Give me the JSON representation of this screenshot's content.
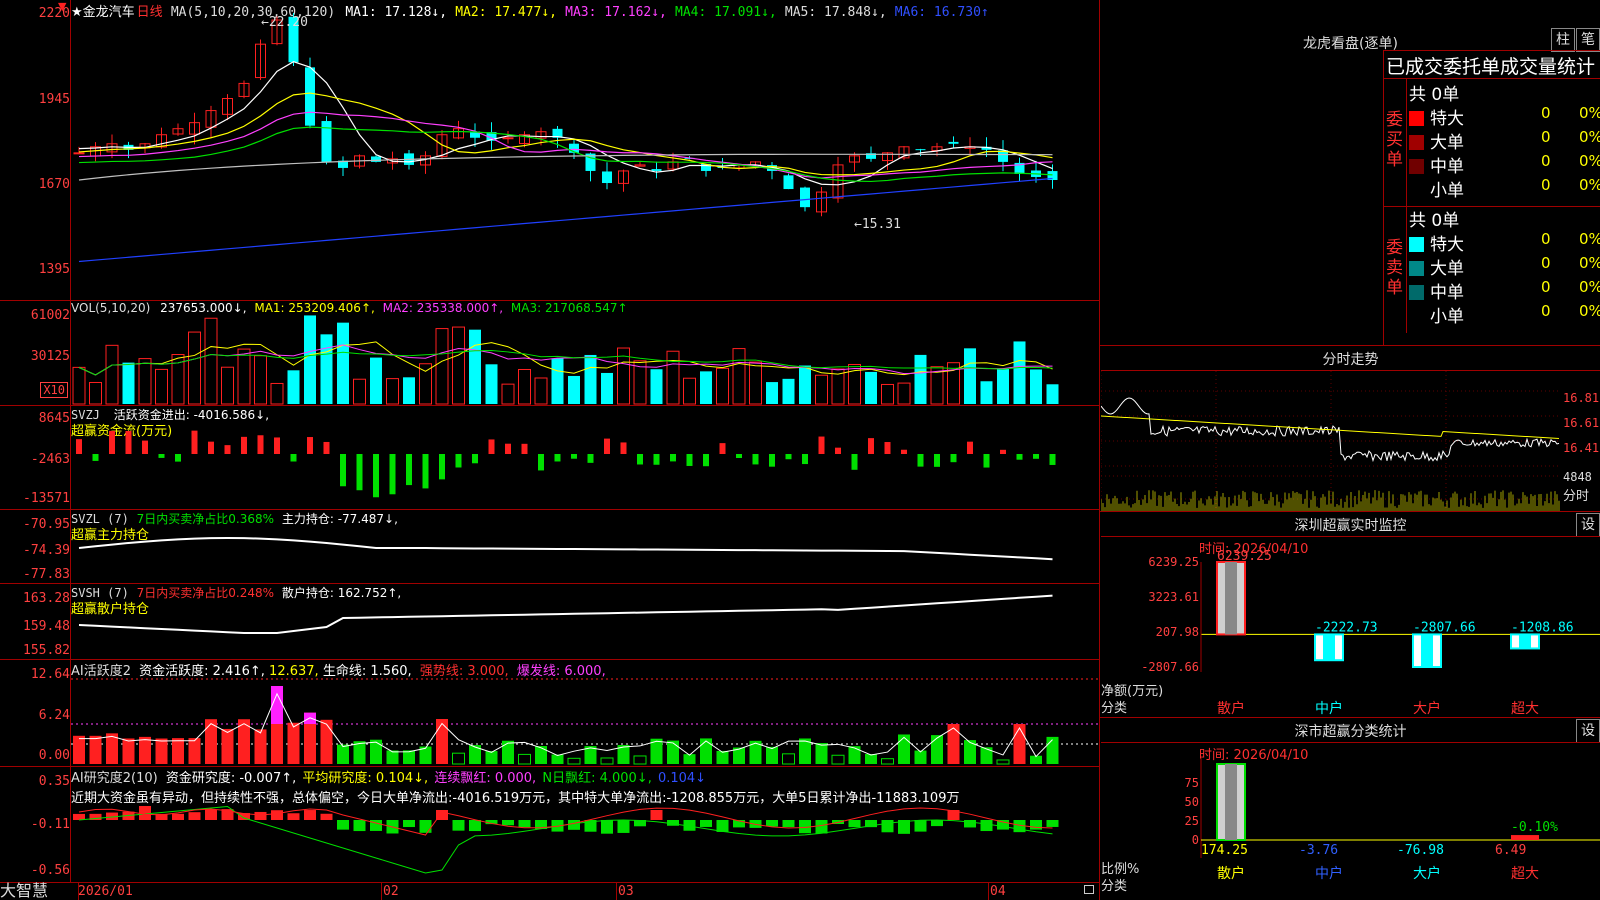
{
  "app": {
    "brand": "大智慧"
  },
  "main": {
    "title_star": "★",
    "stock_name": "金龙汽车",
    "period": "日线",
    "ma_def": "MA(5,10,20,30,60,120)",
    "ma1": "MA1: 17.128↓,",
    "ma2": "MA2: 17.477↓,",
    "ma3": "MA3: 17.162↓,",
    "ma4": "MA4: 17.091↓,",
    "ma5": "MA5: 17.848↓,",
    "ma6": "MA6: 16.730↑",
    "yticks": [
      "2220",
      "1945",
      "1670",
      "1395"
    ],
    "high_label": "←22.20",
    "low_label": "←15.31",
    "colors": {
      "ma1": "#ffffff",
      "ma2": "#ffff00",
      "ma3": "#ff40ff",
      "ma4": "#00e000",
      "ma5": "#c0c0c0",
      "ma6": "#2040ff",
      "up": "#ff2020",
      "down": "#00ffff"
    }
  },
  "vol": {
    "def": "VOL(5,10,20)",
    "v": "237653.000↓,",
    "ma1": "MA1: 253209.406↑,",
    "ma2": "MA2: 235338.000↑,",
    "ma3": "MA3: 217068.547↑",
    "yticks": [
      "61002",
      "30125"
    ],
    "unit": "X10"
  },
  "svzj": {
    "name": "SVZJ",
    "text1": "活跃资金进出: -4016.586↓,",
    "subtitle": "超赢资金流(万元)",
    "yticks": [
      "8645",
      "-2463",
      "-13571"
    ]
  },
  "svzl": {
    "name": "SVZL (7)",
    "text1": "7日内买卖净占比0.368%",
    "text2": "主力持仓: -77.487↓,",
    "subtitle": "超赢主力持仓",
    "yticks": [
      "-70.95",
      "-74.39",
      "-77.83"
    ]
  },
  "svsh": {
    "name": "SVSH (7)",
    "text1": "7日内买卖净占比0.248%",
    "text2": "散户持仓: 162.752↑,",
    "subtitle": "超赢散户持仓",
    "yticks": [
      "163.28",
      "159.48",
      "155.82"
    ]
  },
  "ai1": {
    "name": "AI活跃度2",
    "t1": "资金活跃度: 2.416↑,",
    "t2": "12.637,",
    "t3": "生命线: 1.560,",
    "t4": "强势线: 3.000,",
    "t5": "爆发线: 6.000,",
    "yticks": [
      "12.64",
      "6.24",
      "0.00"
    ]
  },
  "ai2": {
    "name": "AI研究度2(10)",
    "t1": "资金研究度: -0.007↑,",
    "t2": "平均研究度: 0.104↓,",
    "t3": "连续飘红: 0.000,",
    "t4": "N日飘红: 4.000↓,",
    "t5": "0.104↓",
    "comment": "近期大资金虽有异动，但持续性不强，总体偏空，今日大单净流出:-4016.519万元，其中特大单净流出:-1208.855万元，大单5日累计净出-11883.109万",
    "yticks": [
      "0.35",
      "-0.11",
      "-0.56"
    ]
  },
  "xaxis": {
    "labels": [
      "2026/01",
      "02",
      "03",
      "04"
    ]
  },
  "right": {
    "lhb": {
      "title": "龙虎看盘(逐单)",
      "btn1": "柱",
      "btn2": "笔",
      "subtitle": "已成交委托单成交量统计",
      "buy_label": "委买单",
      "sell_label": "委卖单",
      "buy_total": "共 0单",
      "sell_total": "共 0单",
      "buy_rows": [
        {
          "name": "特大",
          "count": "0",
          "pct": "0%",
          "color": "#ff0000"
        },
        {
          "name": "大单",
          "count": "0",
          "pct": "0%",
          "color": "#a00000"
        },
        {
          "name": "中单",
          "count": "0",
          "pct": "0%",
          "color": "#700000"
        },
        {
          "name": "小单",
          "count": "0",
          "pct": "0%",
          "color": ""
        }
      ],
      "sell_rows": [
        {
          "name": "特大",
          "count": "0",
          "pct": "0%",
          "color": "#00ffff"
        },
        {
          "name": "大单",
          "count": "0",
          "pct": "0%",
          "color": "#008888"
        },
        {
          "name": "中单",
          "count": "0",
          "pct": "0%",
          "color": "#006a6a"
        },
        {
          "name": "小单",
          "count": "0",
          "pct": "0%",
          "color": ""
        }
      ]
    },
    "fenshi": {
      "title": "分时走势",
      "prices": [
        "16.81",
        "16.61",
        "16.41"
      ],
      "vol": "4848",
      "unit": "分时"
    },
    "monitor": {
      "title": "深圳超赢实时监控",
      "btn": "设",
      "time": "时间: 2026/04/10",
      "yticks": [
        "6239.25",
        "3223.61",
        "207.98",
        "-2807.66"
      ],
      "ylabel1": "净额(万元)",
      "ylabel2": "分类",
      "categories": [
        "散户",
        "中户",
        "大户",
        "超大"
      ],
      "values_label": [
        "6239.25",
        "-2222.73",
        "-2807.66",
        "-1208.86"
      ]
    },
    "classify": {
      "title": "深市超赢分类统计",
      "btn": "设",
      "time": "时间: 2026/04/10",
      "yticks": [
        "75",
        "50",
        "25",
        "0"
      ],
      "ylabel1": "比例%",
      "ylabel2": "分类",
      "categories": [
        "散户",
        "中户",
        "大户",
        "超大"
      ],
      "values": [
        "174.25",
        "-3.76",
        "-76.98",
        "6.49"
      ],
      "top_label": "-0.10%"
    }
  },
  "chart_data": {
    "type": "bar",
    "title": "深圳超赢实时监控",
    "categories": [
      "散户",
      "中户",
      "大户",
      "超大"
    ],
    "values": [
      6239.25,
      -2222.73,
      -2807.66,
      -1208.86
    ],
    "ylabel": "净额(万元)",
    "ylim": [
      -2807.66,
      6239.25
    ]
  }
}
